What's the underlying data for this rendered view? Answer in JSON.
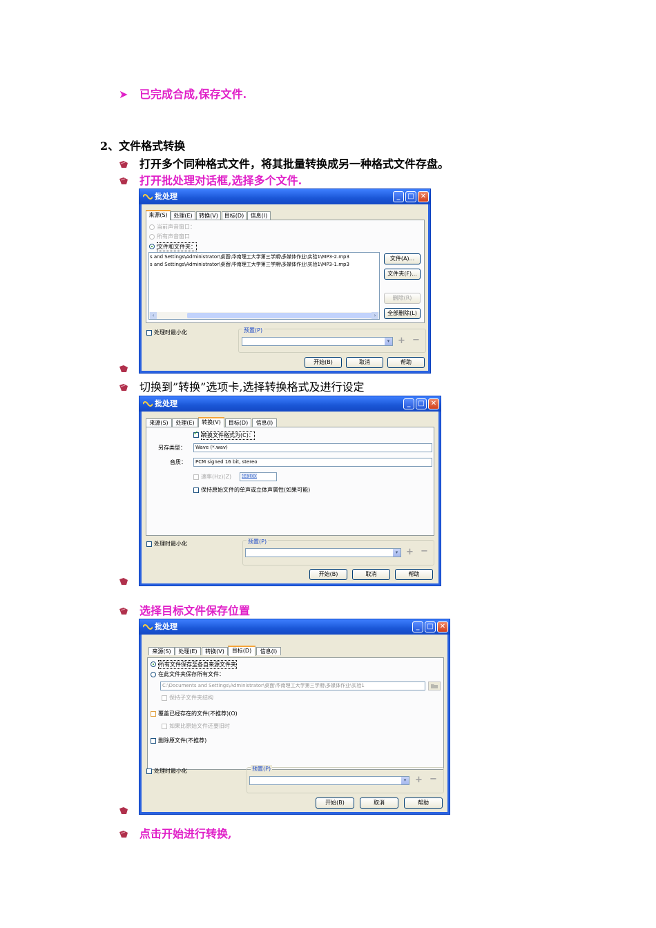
{
  "lines": {
    "done": "已完成合成,保存文件.",
    "section": "2、文件格式转换",
    "step1": "打开多个同种格式文件，将其批量转换成另一种格式文件存盘。",
    "step2": "打开批处理对话框,选择多个文件.",
    "step3": "切换到”转换”选项卡,选择转换格式及进行设定",
    "step4": "选择目标文件保存位置",
    "step5": "点击开始进行转换,"
  },
  "dialog": {
    "title": "批处理",
    "tabs": [
      "来源(S)",
      "处理(E)",
      "转换(V)",
      "目标(D)",
      "信息(I)"
    ],
    "minimize_label": "处理时最小化",
    "preset_label": "预置(P)",
    "start_button": "开始(B)",
    "cancel_button": "取消",
    "help_button": "帮助"
  },
  "source_tab": {
    "radio_current": "当前声音窗口：",
    "radio_all": "所有声音窗口",
    "radio_files": "文件和文件夹：",
    "files": [
      "s and Settings\\Administrator\\桌面\\华南理工大学第三学期\\多媒体作业\\实验1\\MP3-2.mp3",
      "s and Settings\\Administrator\\桌面\\华南理工大学第三学期\\多媒体作业\\实验1\\MP3-1.mp3"
    ],
    "btn_files": "文件(A)...",
    "btn_folder": "文件夹(F)...",
    "btn_delete": "删除(R)",
    "btn_delete_all": "全部删除(L)"
  },
  "convert_tab": {
    "convert_check": "转换文件格式为(C)：",
    "save_type_label": "另存类型：",
    "save_type_value": "Wave (*.wav)",
    "quality_label": "音质：",
    "quality_value": "PCM signed 16 bit, stereo",
    "rate_label": "速率(Hz)(Z)",
    "rate_value": "44100",
    "keep_check": "保持原始文件的单声或立体声属性(如果可能)"
  },
  "target_tab": {
    "radio_same": "所有文件保存至各自来源文件夹",
    "radio_folder": "在此文件夹保存所有文件：",
    "folder_path": "C:\\Documents and Settings\\Administrator\\桌面\\华南理工大学第三学期\\多媒体作业\\实验1",
    "keep_structure": "保持子文件夹结构",
    "overwrite": "覆盖已经存在的文件(不推荐)(O)",
    "if_older": "如果比原始文件还要旧时",
    "delete_original": "删除原文件(不推荐)"
  },
  "colors": {
    "accent_text": "#e020c8",
    "xp_title": "#1a56d6"
  }
}
